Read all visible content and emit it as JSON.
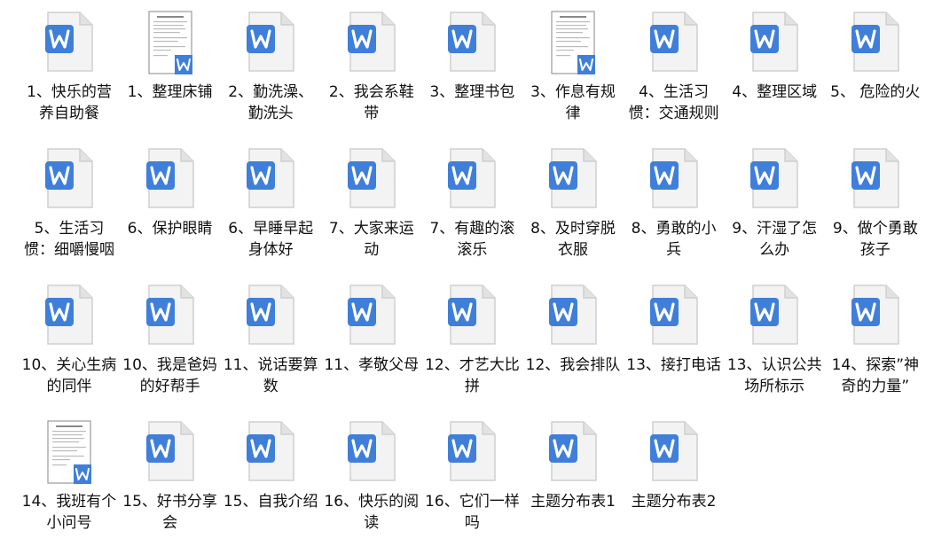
{
  "files": [
    {
      "label": "1、快乐的营养自助餐",
      "type": "doc"
    },
    {
      "label": "1、整理床铺",
      "type": "thumb"
    },
    {
      "label": "2、勤洗澡、勤洗头",
      "type": "doc"
    },
    {
      "label": "2、我会系鞋带",
      "type": "doc"
    },
    {
      "label": "3、整理书包",
      "type": "doc"
    },
    {
      "label": "3、作息有规律",
      "type": "thumb"
    },
    {
      "label": "4、生活习惯：交通规则",
      "type": "doc"
    },
    {
      "label": "4、整理区域",
      "type": "doc"
    },
    {
      "label": "5、 危险的火",
      "type": "doc"
    },
    {
      "label": "5、生活习惯：细嚼慢咽",
      "type": "doc"
    },
    {
      "label": "6、保护眼睛",
      "type": "doc"
    },
    {
      "label": "6、早睡早起身体好",
      "type": "doc"
    },
    {
      "label": "7、大家来运动",
      "type": "doc"
    },
    {
      "label": "7、有趣的滚滚乐",
      "type": "doc"
    },
    {
      "label": "8、及时穿脱衣服",
      "type": "doc"
    },
    {
      "label": "8、勇敢的小兵",
      "type": "doc"
    },
    {
      "label": "9、汗湿了怎么办",
      "type": "doc"
    },
    {
      "label": "9、做个勇敢孩子",
      "type": "doc"
    },
    {
      "label": "10、关心生病的同伴",
      "type": "doc"
    },
    {
      "label": "10、我是爸妈的好帮手",
      "type": "doc"
    },
    {
      "label": "11、说话要算数",
      "type": "doc"
    },
    {
      "label": "11、孝敬父母",
      "type": "doc"
    },
    {
      "label": "12、才艺大比拼",
      "type": "doc"
    },
    {
      "label": "12、我会排队",
      "type": "doc"
    },
    {
      "label": "13、接打电话",
      "type": "doc"
    },
    {
      "label": "13、认识公共场所标示",
      "type": "doc"
    },
    {
      "label": "14、探索”神奇的力量”",
      "type": "doc"
    },
    {
      "label": "14、我班有个小问号",
      "type": "thumb"
    },
    {
      "label": "15、好书分享会",
      "type": "doc"
    },
    {
      "label": "15、自我介绍",
      "type": "doc"
    },
    {
      "label": "16、快乐的阅读",
      "type": "doc"
    },
    {
      "label": "16、它们一样吗",
      "type": "doc"
    },
    {
      "label": "主题分布表1",
      "type": "doc"
    },
    {
      "label": "主题分布表2",
      "type": "doc"
    }
  ],
  "icons": {
    "doc": "word-document-icon",
    "thumb": "document-thumbnail-icon"
  },
  "colors": {
    "word_blue": "#3f7fd9",
    "page_gray": "#f3f3f3"
  }
}
